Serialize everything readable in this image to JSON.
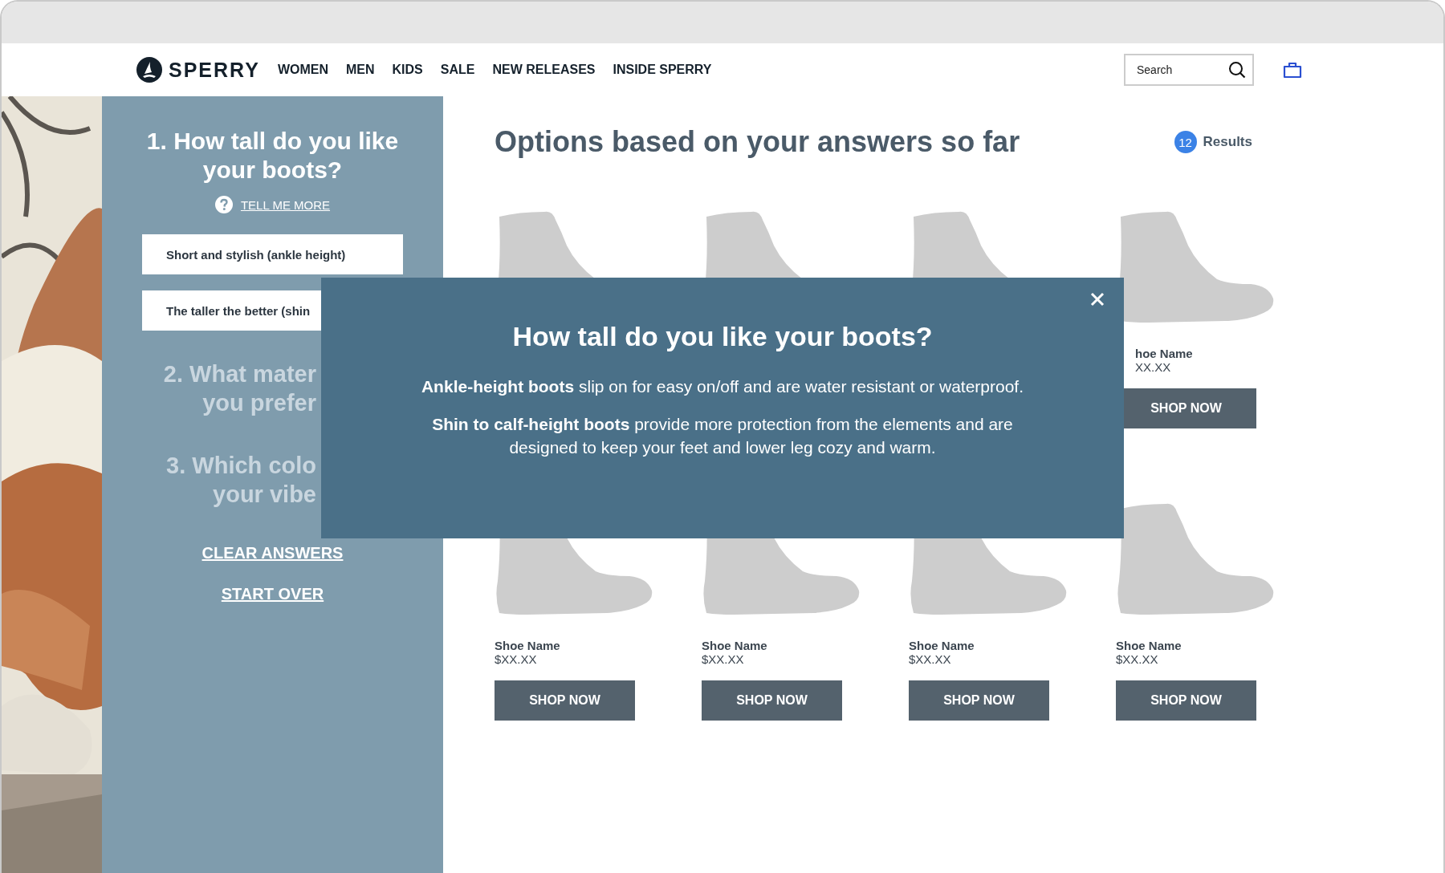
{
  "header": {
    "logo": "SPERRY",
    "nav": [
      "WOMEN",
      "MEN",
      "KIDS",
      "SALE",
      "NEW RELEASES",
      "INSIDE SPERRY"
    ],
    "search": {
      "placeholder": "Search"
    }
  },
  "quiz": {
    "questions": [
      {
        "lines": [
          "1. How tall do you like",
          "your boots?"
        ],
        "active": true,
        "help_link": "TELL ME MORE",
        "options": [
          "Short and stylish (ankle height)",
          "The taller the better (shin"
        ]
      },
      {
        "lines": [
          "2. What mater",
          "you prefer"
        ],
        "active": false
      },
      {
        "lines": [
          "3. Which colo",
          "your vibe"
        ],
        "active": false
      }
    ],
    "links": [
      "CLEAR ANSWERS",
      "START OVER"
    ]
  },
  "results": {
    "title": "Options based on your answers so far",
    "count": "12",
    "count_label": "Results",
    "rows": [
      [
        {
          "kind": "boot"
        },
        {
          "kind": "boot"
        },
        {
          "kind": "boot"
        },
        {
          "kind": "boot",
          "name": "hoe Name",
          "price": "XX.XX",
          "button": "SHOP NOW"
        }
      ],
      [
        {
          "kind": "boot",
          "name": "Shoe Name",
          "price": "$XX.XX",
          "button": "SHOP NOW"
        },
        {
          "kind": "boot",
          "name": "Shoe Name",
          "price": "$XX.XX",
          "button": "SHOP NOW"
        },
        {
          "kind": "boot",
          "name": "Shoe Name",
          "price": "$XX.XX",
          "button": "SHOP NOW"
        },
        {
          "kind": "boot",
          "name": "Shoe Name",
          "price": "$XX.XX",
          "button": "SHOP NOW"
        }
      ]
    ]
  },
  "modal": {
    "title": "How tall do you like your boots?",
    "paragraphs": [
      "**Ankle-height boots** slip on for easy on/off and are water resistant or waterproof.",
      "**Shin to calf-height boots** provide more protection from the elements and are designed to keep your feet and lower leg cozy and warm."
    ]
  }
}
